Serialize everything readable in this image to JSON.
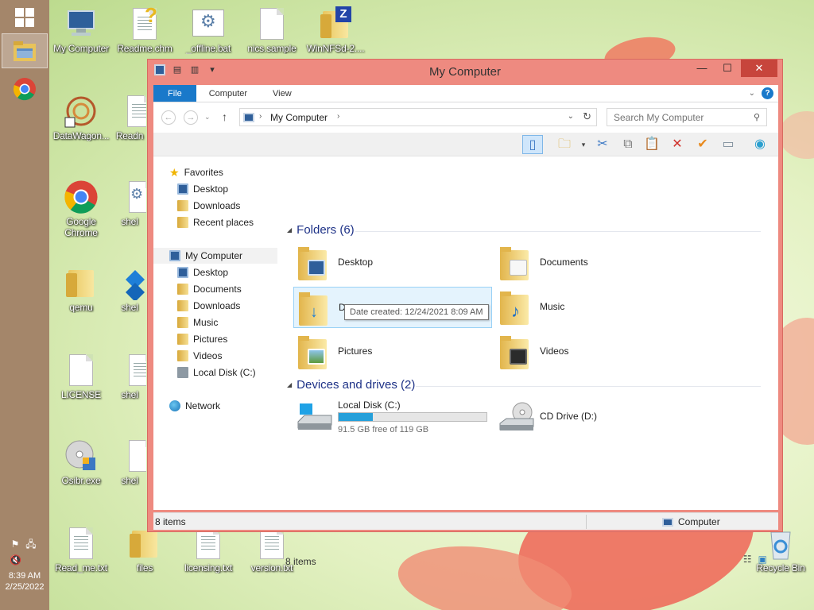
{
  "taskbar": {
    "time": "8:39 AM",
    "date": "2/25/2022"
  },
  "desktop_icons": [
    {
      "label": "My Computer",
      "icon": "computer-icon"
    },
    {
      "label": "Readme.chm",
      "icon": "help-file-icon"
    },
    {
      "label": "_offline.bat",
      "icon": "batch-file-icon"
    },
    {
      "label": "nics.sample",
      "icon": "file-icon"
    },
    {
      "label": "WinNFSd-2....",
      "icon": "zip-folder-icon"
    },
    {
      "label": "DataWagon...",
      "icon": "app-shortcut-icon"
    },
    {
      "label": "Readn",
      "icon": "text-file-icon"
    },
    {
      "label": "Google Chrome",
      "icon": "chrome-icon"
    },
    {
      "label": "shel",
      "icon": "settings-file-icon"
    },
    {
      "label": "qemu",
      "icon": "folder-icon"
    },
    {
      "label": "shel",
      "icon": "shortcut-icon"
    },
    {
      "label": "LICENSE",
      "icon": "file-icon"
    },
    {
      "label": "shel",
      "icon": "text-file-icon"
    },
    {
      "label": "Osibr.exe",
      "icon": "cd-installer-icon"
    },
    {
      "label": "shel",
      "icon": "file-icon"
    },
    {
      "label": "Read_me.txt",
      "icon": "text-file-icon"
    },
    {
      "label": "files",
      "icon": "folder-icon"
    },
    {
      "label": "licensing.txt",
      "icon": "text-file-icon"
    },
    {
      "label": "version.txt",
      "icon": "text-file-icon"
    },
    {
      "label": "Recycle Bin",
      "icon": "recycle-bin-icon"
    }
  ],
  "window": {
    "title": "My Computer",
    "tabs": [
      "File",
      "Computer",
      "View"
    ],
    "address": "My Computer",
    "search_placeholder": "Search My Computer",
    "nav": {
      "favorites": "Favorites",
      "favorites_items": [
        "Desktop",
        "Downloads",
        "Recent places"
      ],
      "computer": "My Computer",
      "computer_items": [
        "Desktop",
        "Documents",
        "Downloads",
        "Music",
        "Pictures",
        "Videos",
        "Local Disk (C:)"
      ],
      "network": "Network"
    },
    "folders_header": "Folders (6)",
    "folders": [
      "Desktop",
      "Documents",
      "Downloads",
      "Music",
      "Pictures",
      "Videos"
    ],
    "downloads_partial": "Do",
    "tooltip": "Date created: 12/24/2021 8:09 AM",
    "drives_header": "Devices and drives (2)",
    "drives": [
      {
        "name": "Local Disk (C:)",
        "free": "91.5 GB free of 119 GB",
        "used_fraction": 0.23
      },
      {
        "name": "CD Drive (D:)"
      }
    ],
    "item_count": "8 items",
    "status_left": "8 items",
    "status_right": "Computer"
  },
  "colors": {
    "title_bar": "#ee8a80",
    "close_button": "#c7453c",
    "file_tab": "#1979ca",
    "group_header": "#1e3287",
    "progress": "#26a0da",
    "taskbar": "#a4866a"
  }
}
